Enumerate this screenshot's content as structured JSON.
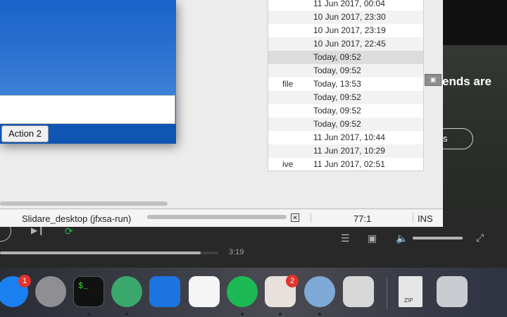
{
  "spotify": {
    "hero_text": "ends are",
    "hero_button": "s",
    "elapsed_time": "3:19",
    "progress_fraction": 0.92,
    "volume_fraction": 0.98
  },
  "file_list": [
    {
      "name": "",
      "date": "11 Jun 2017, 00:04"
    },
    {
      "name": "",
      "date": "10 Jun 2017, 23:30"
    },
    {
      "name": "",
      "date": "10 Jun 2017, 23:19"
    },
    {
      "name": "",
      "date": "10 Jun 2017, 22:45"
    },
    {
      "name": "",
      "date": "Today, 09:52"
    },
    {
      "name": "",
      "date": "Today, 09:52"
    },
    {
      "name": "file",
      "date": "Today, 13:53"
    },
    {
      "name": "",
      "date": "Today, 09:52"
    },
    {
      "name": "",
      "date": "Today, 09:52"
    },
    {
      "name": "",
      "date": "Today, 09:52"
    },
    {
      "name": "",
      "date": "11 Jun 2017, 10:44"
    },
    {
      "name": "",
      "date": "11 Jun 2017, 10:29"
    },
    {
      "name": "ive",
      "date": "11 Jun 2017, 02:51"
    }
  ],
  "dialog": {
    "action_button": "Action 2"
  },
  "status_bar": {
    "task": "Slidare_desktop (jfxsa-run)",
    "cancel_glyph": "✕",
    "position": "77:1",
    "mode": "INS"
  },
  "dock": {
    "items": [
      {
        "name": "app-store-icon",
        "color": "#1a7ff0",
        "badge": "1"
      },
      {
        "name": "system-preferences-icon",
        "color": "#8e8e93",
        "badge": ""
      },
      {
        "name": "terminal-icon",
        "color": "#111111",
        "badge": ""
      },
      {
        "name": "atom-icon",
        "color": "#3aa86c",
        "badge": ""
      },
      {
        "name": "xcode-icon",
        "color": "#1c74e0",
        "badge": ""
      },
      {
        "name": "launchpad-grid-icon",
        "color": "#f5f5f5",
        "badge": ""
      },
      {
        "name": "spotify-icon",
        "color": "#1db954",
        "badge": ""
      },
      {
        "name": "slack-icon",
        "color": "#e8e1db",
        "badge": "2"
      },
      {
        "name": "virtualbox-icon",
        "color": "#7fa9d6",
        "badge": ""
      },
      {
        "name": "java-cup-icon",
        "color": "#d8d8d8",
        "badge": ""
      },
      {
        "name": "zip-archive-icon",
        "color": "#e6e6e6",
        "badge": ""
      },
      {
        "name": "trash-icon",
        "color": "#c9cdd2",
        "badge": ""
      }
    ],
    "zip_label": "ZIP",
    "terminal_prompt": "$_"
  }
}
